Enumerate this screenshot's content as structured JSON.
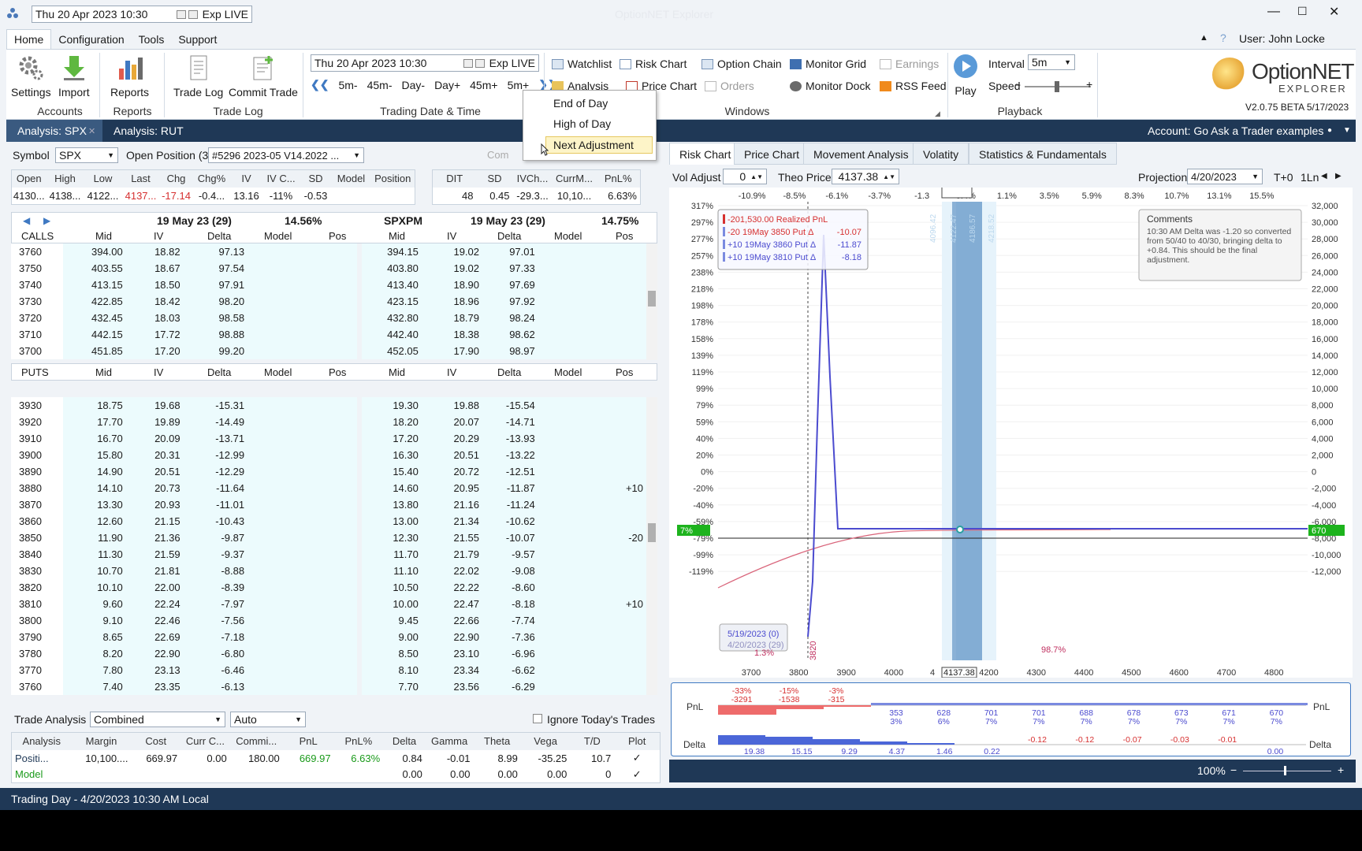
{
  "titlebar": {
    "datetime": "Thu 20 Apr 2023 10:30",
    "exp": "Exp LIVE",
    "win_title": "OptionNET Explorer",
    "user": "User: John Locke"
  },
  "menu": {
    "home": "Home",
    "configuration": "Configuration",
    "tools": "Tools",
    "support": "Support"
  },
  "ribbon": {
    "settings": "Settings",
    "import": "Import",
    "reports": "Reports",
    "trade_log": "Trade Log",
    "commit_trade": "Commit Trade",
    "group_accounts": "Accounts",
    "group_reports": "Reports",
    "group_tradelog": "Trade Log",
    "group_trading": "Trading Date & Time",
    "group_windows": "Windows",
    "group_playback": "Playback",
    "datetime": "Thu 20 Apr 2023 10:30",
    "exp": "Exp LIVE",
    "steps": [
      "5m-",
      "45m-",
      "Day-",
      "Day+",
      "45m+",
      "5m+"
    ],
    "watchlist": "Watchlist",
    "risk_chart": "Risk Chart",
    "option_chain": "Option Chain",
    "monitor_grid": "Monitor Grid",
    "earnings": "Earnings",
    "analysis": "Analysis",
    "price_chart": "Price Chart",
    "orders": "Orders",
    "monitor_dock": "Monitor Dock",
    "rss_feed": "RSS Feed",
    "play": "Play",
    "interval_label": "Interval",
    "interval_value": "5m",
    "speed_label": "Speed",
    "logo_main": "OptionNET",
    "logo_sub": "EXPLORER",
    "version": "V2.0.75 BETA 5/17/2023"
  },
  "dropdown": {
    "end_of_day": "End of Day",
    "high_of_day": "High of Day",
    "next_adjustment": "Next Adjustment"
  },
  "tabs": {
    "tab1": "Analysis: SPX",
    "tab2": "Analysis: RUT",
    "account": "Account: Go Ask a Trader examples"
  },
  "symbol": {
    "label": "Symbol",
    "value": "SPX",
    "open_pos_label": "Open Position (3)",
    "open_pos_value": "#5296 2023-05 V14.2022 ...",
    "commit": "Com"
  },
  "quote": {
    "headers": [
      "Open",
      "High",
      "Low",
      "Last",
      "Chg",
      "Chg%",
      "IV",
      "IV C...",
      "SD",
      "Model",
      "Position"
    ],
    "values": [
      "4130...",
      "4138...",
      "4122...",
      "4137...",
      "-17.14",
      "-0.4...",
      "13.16",
      "-11%",
      "-0.53",
      "",
      ""
    ],
    "pos_headers": [
      "DIT",
      "SD",
      "IVCh...",
      "CurrM...",
      "PnL%"
    ],
    "pos_values": [
      "48",
      "0.45",
      "-29.3...",
      "10,10...",
      "6.63%"
    ]
  },
  "chain": {
    "left_exp": "19 May 23 (29)",
    "left_iv": "14.56%",
    "right_sym": "SPXPM",
    "right_exp": "19 May 23 (29)",
    "right_iv": "14.75%",
    "cols": [
      "Mid",
      "IV",
      "Delta",
      "Model",
      "Pos"
    ],
    "calls_label": "CALLS",
    "puts_label": "PUTS",
    "calls": [
      [
        "3760",
        "394.00",
        "18.82",
        "97.13",
        "394.15",
        "19.02",
        "97.01",
        ""
      ],
      [
        "3750",
        "403.55",
        "18.67",
        "97.54",
        "403.80",
        "19.02",
        "97.33",
        ""
      ],
      [
        "3740",
        "413.15",
        "18.50",
        "97.91",
        "413.40",
        "18.90",
        "97.69",
        ""
      ],
      [
        "3730",
        "422.85",
        "18.42",
        "98.20",
        "423.15",
        "18.96",
        "97.92",
        ""
      ],
      [
        "3720",
        "432.45",
        "18.03",
        "98.58",
        "432.80",
        "18.79",
        "98.24",
        ""
      ],
      [
        "3710",
        "442.15",
        "17.72",
        "98.88",
        "442.40",
        "18.38",
        "98.62",
        ""
      ],
      [
        "3700",
        "451.85",
        "17.20",
        "99.20",
        "452.05",
        "17.90",
        "98.97",
        ""
      ]
    ],
    "puts": [
      [
        "3930",
        "18.75",
        "19.68",
        "-15.31",
        "19.30",
        "19.88",
        "-15.54",
        ""
      ],
      [
        "3920",
        "17.70",
        "19.89",
        "-14.49",
        "18.20",
        "20.07",
        "-14.71",
        ""
      ],
      [
        "3910",
        "16.70",
        "20.09",
        "-13.71",
        "17.20",
        "20.29",
        "-13.93",
        ""
      ],
      [
        "3900",
        "15.80",
        "20.31",
        "-12.99",
        "16.30",
        "20.51",
        "-13.22",
        ""
      ],
      [
        "3890",
        "14.90",
        "20.51",
        "-12.29",
        "15.40",
        "20.72",
        "-12.51",
        ""
      ],
      [
        "3880",
        "14.10",
        "20.73",
        "-11.64",
        "14.60",
        "20.95",
        "-11.87",
        "+10"
      ],
      [
        "3870",
        "13.30",
        "20.93",
        "-11.01",
        "13.80",
        "21.16",
        "-11.24",
        ""
      ],
      [
        "3860",
        "12.60",
        "21.15",
        "-10.43",
        "13.00",
        "21.34",
        "-10.62",
        ""
      ],
      [
        "3850",
        "11.90",
        "21.36",
        "-9.87",
        "12.30",
        "21.55",
        "-10.07",
        "-20"
      ],
      [
        "3840",
        "11.30",
        "21.59",
        "-9.37",
        "11.70",
        "21.79",
        "-9.57",
        ""
      ],
      [
        "3830",
        "10.70",
        "21.81",
        "-8.88",
        "11.10",
        "22.02",
        "-9.08",
        ""
      ],
      [
        "3820",
        "10.10",
        "22.00",
        "-8.39",
        "10.50",
        "22.22",
        "-8.60",
        ""
      ],
      [
        "3810",
        "9.60",
        "22.24",
        "-7.97",
        "10.00",
        "22.47",
        "-8.18",
        "+10"
      ],
      [
        "3800",
        "9.10",
        "22.46",
        "-7.56",
        "9.45",
        "22.66",
        "-7.74",
        ""
      ],
      [
        "3790",
        "8.65",
        "22.69",
        "-7.18",
        "9.00",
        "22.90",
        "-7.36",
        ""
      ],
      [
        "3780",
        "8.20",
        "22.90",
        "-6.80",
        "8.50",
        "23.10",
        "-6.96",
        ""
      ],
      [
        "3770",
        "7.80",
        "23.13",
        "-6.46",
        "8.10",
        "23.34",
        "-6.62",
        ""
      ],
      [
        "3760",
        "7.40",
        "23.35",
        "-6.13",
        "7.70",
        "23.56",
        "-6.29",
        ""
      ]
    ]
  },
  "trade_analysis": {
    "label": "Trade Analysis",
    "mode": "Combined",
    "auto": "Auto",
    "ignore": "Ignore Today's Trades",
    "headers": [
      "Analysis",
      "Margin",
      "Cost",
      "Curr C...",
      "Commi...",
      "PnL",
      "PnL%",
      "Delta",
      "Gamma",
      "Theta",
      "Vega",
      "T/D",
      "Plot"
    ],
    "row1": [
      "Positi...",
      "10,100....",
      "669.97",
      "0.00",
      "180.00",
      "669.97",
      "6.63%",
      "0.84",
      "-0.01",
      "8.99",
      "-35.25",
      "10.7",
      "✓"
    ],
    "row2": [
      "Model",
      "",
      "",
      "",
      "",
      "",
      "",
      "0.00",
      "0.00",
      "0.00",
      "0.00",
      "0",
      "✓"
    ]
  },
  "right": {
    "tabs": [
      "Risk Chart",
      "Price Chart",
      "Movement Analysis",
      "Volatity",
      "Statistics & Fundamentals"
    ],
    "vol_adjust_label": "Vol Adjust",
    "vol_adjust": "0",
    "theo_label": "Theo Price",
    "theo": "4137.38",
    "proj_label": "Projection",
    "proj": "4/20/2023",
    "tplus": "T+0",
    "ln": "1Ln",
    "top_pct": [
      "-10.9%",
      "-8.5%",
      "-6.1%",
      "-3.7%",
      "-1.3",
      "-0.4%",
      "1.1%",
      "3.5%",
      "5.9%",
      "8.3%",
      "10.7%",
      "13.1%",
      "15.5%"
    ],
    "left_pct": [
      "317%",
      "297%",
      "277%",
      "257%",
      "238%",
      "218%",
      "198%",
      "178%",
      "158%",
      "139%",
      "119%",
      "99%",
      "79%",
      "59%",
      "40%",
      "20%",
      "0%",
      "-20%",
      "-40%",
      "-59%",
      "-79%",
      "-99%",
      "-119%"
    ],
    "right_vals": [
      "32,000",
      "30,000",
      "28,000",
      "26,000",
      "24,000",
      "22,000",
      "20,000",
      "18,000",
      "16,000",
      "14,000",
      "12,000",
      "10,000",
      "8,000",
      "6,000",
      "4,000",
      "2,000",
      "0",
      "-2,000",
      "-4,000",
      "-6,000",
      "-8,000",
      "-10,000",
      "-12,000"
    ],
    "x_vals": [
      "3700",
      "3800",
      "3900",
      "4000",
      "4",
      "4200",
      "4300",
      "4400",
      "4500",
      "4600",
      "4700",
      "4800"
    ],
    "price_tag": "4137.38",
    "pnl_tag_left": "7%",
    "pnl_tag_right": "670",
    "legend": [
      "-201,530.00 Realized PnL",
      "-20 19May 3850 Put Δ",
      "+10 19May 3860 Put Δ",
      "+10 19May 3810 Put Δ"
    ],
    "legend_vals": [
      "",
      "-10.07",
      "-11.87",
      "-8.18"
    ],
    "comments_title": "Comments",
    "comments": "10:30 AM Delta was -1.20 so converted from 50/40 to 40/30, bringing delta to +0.84. This should be the final adjustment.",
    "strike_tags": [
      "4096.42",
      "4122.47",
      "4186.57",
      "4218.52"
    ],
    "date_box1": "5/19/2023 (0)",
    "date_box2": "4/20/2023 (29)",
    "date_pct": "1.3%",
    "strike_label": "3820",
    "mid_pct": "98.7%",
    "pnl_row_label": "PnL",
    "delta_row_label": "Delta",
    "pnl_neg_top": [
      "-33%",
      "-15%",
      "-3%"
    ],
    "pnl_neg_bot": [
      "-3291",
      "-1538",
      "-315"
    ],
    "pnl_pos_top": [
      "353",
      "628",
      "701",
      "701",
      "688",
      "678",
      "673",
      "671",
      "670"
    ],
    "pnl_pos_bot": [
      "3%",
      "6%",
      "7%",
      "7%",
      "7%",
      "7%",
      "7%",
      "7%",
      "7%"
    ],
    "delta_pos": [
      "19.38",
      "15.15",
      "9.29",
      "4.37",
      "1.46",
      "0.22"
    ],
    "delta_neg": [
      "-0.12",
      "-0.12",
      "-0.07",
      "-0.03",
      "-0.01"
    ],
    "delta_zero": "0.00",
    "zoom": "100%"
  },
  "status": "Trading Day - 4/20/2023 10:30 AM Local",
  "colors": {
    "navy": "#1f3856",
    "green": "#1db31d",
    "pnl_line": "#4b4bcf",
    "red": "#c0392b"
  }
}
